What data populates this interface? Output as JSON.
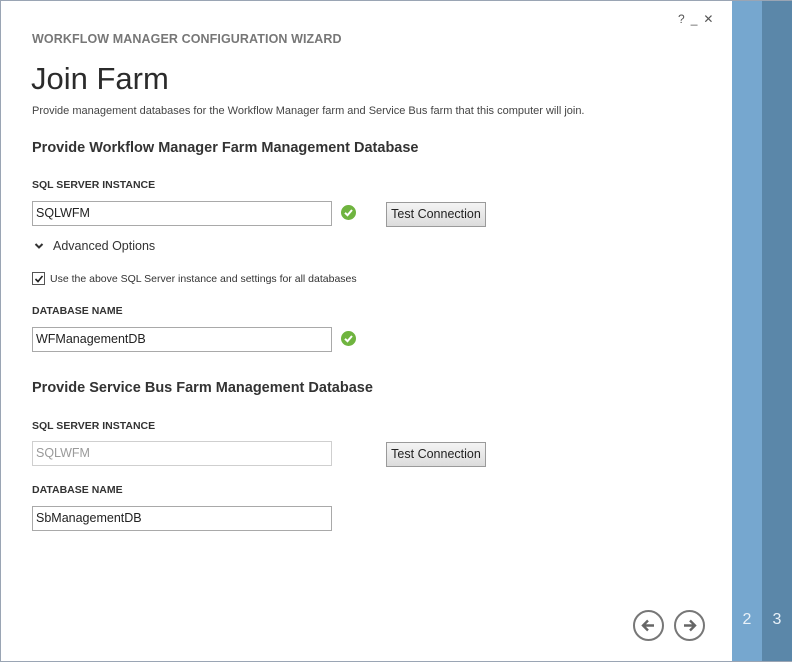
{
  "window": {
    "help_glyph": "?",
    "minimize_glyph": "_",
    "close_glyph": "✕"
  },
  "wizard": {
    "title": "WORKFLOW MANAGER CONFIGURATION WIZARD",
    "page_title": "Join Farm",
    "description": "Provide management databases for the Workflow Manager farm and Service Bus farm that this computer will join."
  },
  "wf_section": {
    "title": "Provide Workflow Manager Farm Management Database",
    "sql_label": "SQL SERVER INSTANCE",
    "sql_value": "SQLWFM",
    "sql_valid": true,
    "test_button": "Test Connection",
    "advanced_label": "Advanced Options",
    "use_same_label": "Use the above SQL Server instance and settings for all databases",
    "use_same_checked": true,
    "db_label": "DATABASE NAME",
    "db_value": "WFManagementDB",
    "db_valid": true
  },
  "sb_section": {
    "title": "Provide Service Bus Farm Management Database",
    "sql_label": "SQL SERVER INSTANCE",
    "sql_value": "SQLWFM",
    "test_button": "Test Connection",
    "db_label": "DATABASE NAME",
    "db_value": "SbManagementDB"
  },
  "steps": {
    "step2": "2",
    "step3": "3"
  },
  "colors": {
    "step2": "#76a7cf",
    "step3": "#5b87a9",
    "valid": "#6fb43f"
  },
  "icons": {
    "back": "back-arrow-icon",
    "next": "next-arrow-icon",
    "valid": "checkmark-icon",
    "expand": "chevron-down-icon"
  }
}
